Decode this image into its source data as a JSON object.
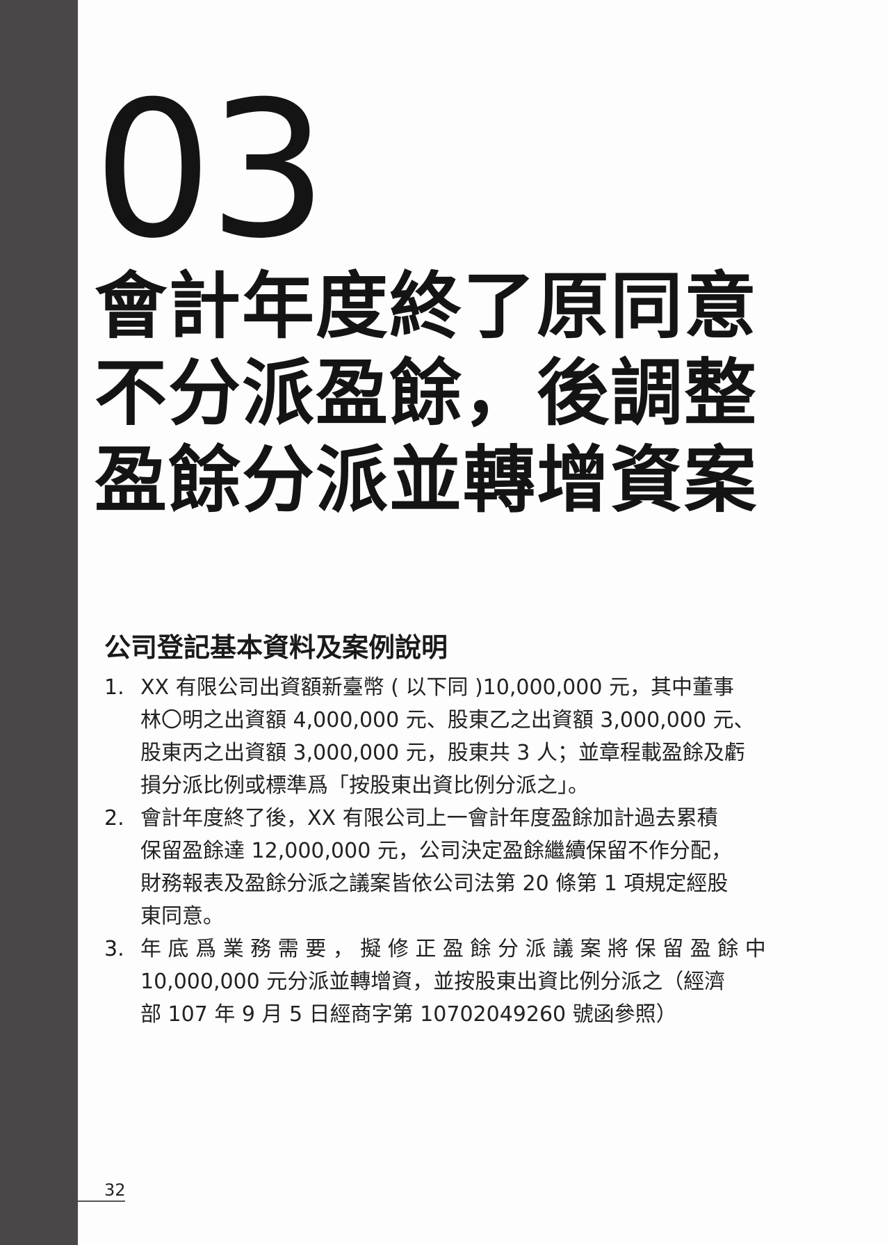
{
  "chapter_number": "03",
  "title_lines": [
    "會計年度終了原同意",
    "不分派盈餘，後調整",
    "盈餘分派並轉增資案"
  ],
  "section_heading": "公司登記基本資料及案例說明",
  "items": [
    {
      "num": "1.",
      "lines": [
        "XX 有限公司出資額新臺幣 ( 以下同 )10,000,000 元，其中董事",
        "林〇明之出資額 4,000,000 元、股東乙之出資額 3,000,000 元、",
        "股東丙之出資額 3,000,000 元，股東共 3 人；並章程載盈餘及虧",
        "損分派比例或標準爲「按股東出資比例分派之」。"
      ]
    },
    {
      "num": "2.",
      "lines": [
        "會計年度終了後，XX 有限公司上一會計年度盈餘加計過去累積",
        "保留盈餘達 12,000,000 元，公司決定盈餘繼續保留不作分配，",
        "財務報表及盈餘分派之議案皆依公司法第 20 條第 1 項規定經股",
        "東同意。"
      ]
    },
    {
      "num": "3.",
      "lines": [
        "年 底 爲 業 務 需 要 ， 擬 修 正 盈 餘 分 派 議 案 將 保 留 盈 餘 中",
        "10,000,000 元分派並轉增資，並按股東出資比例分派之（經濟",
        "部 107 年 9 月 5 日經商字第 10702049260 號函參照）"
      ]
    }
  ],
  "page_number": "32",
  "colors": {
    "sidebar": "#4a4748",
    "text": "#141414"
  }
}
